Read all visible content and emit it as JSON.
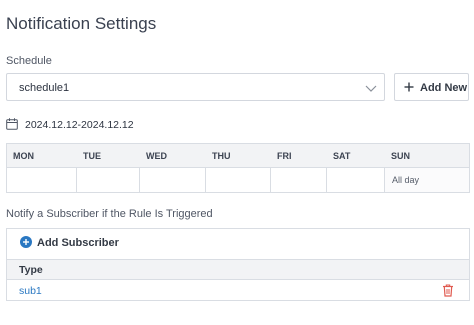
{
  "page": {
    "title": "Notification Settings"
  },
  "schedule": {
    "label": "Schedule",
    "selected": "schedule1",
    "add_new_label": "Add New",
    "date_range": "2024.12.12-2024.12.12"
  },
  "week": {
    "days": [
      "MON",
      "TUE",
      "WED",
      "THU",
      "FRI",
      "SAT",
      "SUN"
    ],
    "cells": [
      "",
      "",
      "",
      "",
      "",
      "",
      "All day"
    ]
  },
  "subscribers": {
    "label": "Notify a Subscriber if the Rule Is Triggered",
    "add_label": "Add Subscriber",
    "column_header": "Type",
    "rows": [
      {
        "type": "sub1"
      }
    ]
  },
  "colors": {
    "accent": "#2a78c2",
    "danger": "#e05a4f",
    "header_bg": "#f2f3f5",
    "border": "#d9dde3"
  },
  "icons": [
    "chevron-down-icon",
    "plus-icon",
    "calendar-icon",
    "plus-circle-icon",
    "trash-icon"
  ]
}
